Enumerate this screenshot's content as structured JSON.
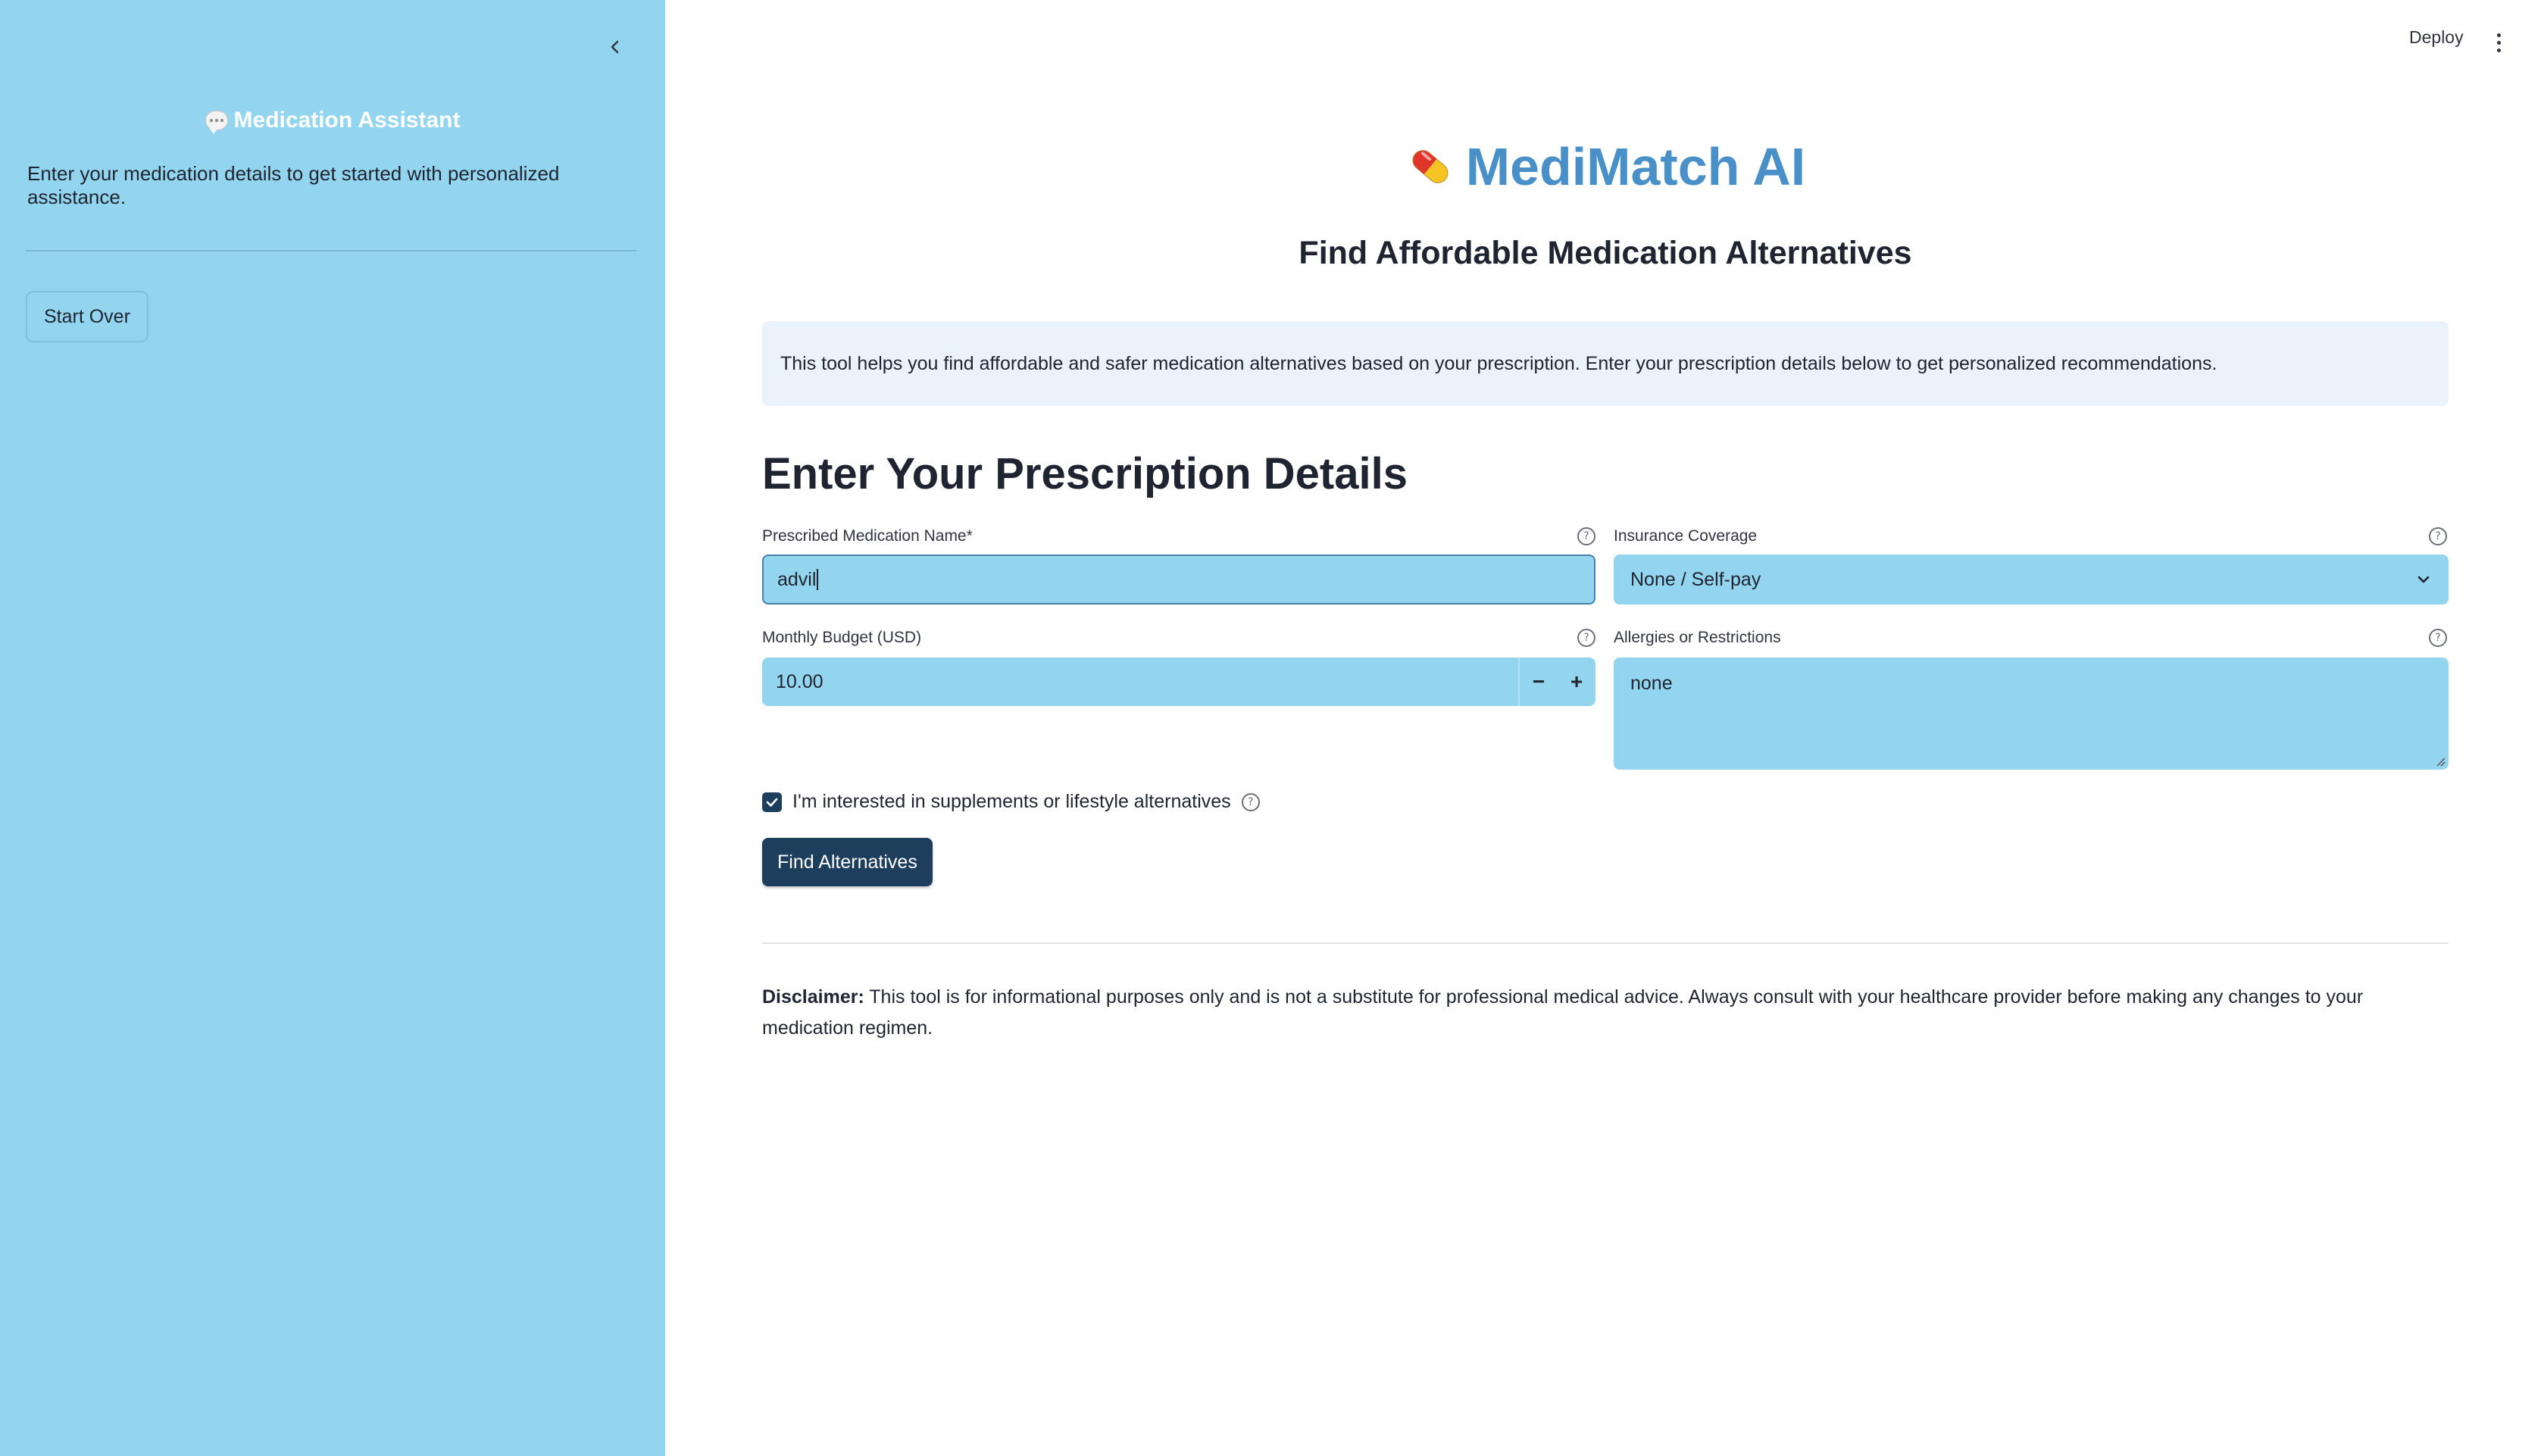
{
  "sidebar": {
    "collapse_icon": "chevron-left-icon",
    "title_icon": "speech-bubble-icon",
    "title": "Medication Assistant",
    "description": "Enter your medication details to get started with personalized assistance.",
    "start_over_label": "Start Over"
  },
  "topbar": {
    "deploy_label": "Deploy",
    "menu_icon": "kebab-menu-icon"
  },
  "header": {
    "app_icon": "pill-icon",
    "app_title": "MediMatch AI",
    "subtitle": "Find Affordable Medication Alternatives"
  },
  "info": {
    "text": "This tool helps you find affordable and safer medication alternatives based on your prescription. Enter your prescription details below to get personalized recommendations."
  },
  "form": {
    "heading": "Enter Your Prescription Details",
    "medication": {
      "label": "Prescribed Medication Name*",
      "value": "advil"
    },
    "insurance": {
      "label": "Insurance Coverage",
      "selected": "None / Self-pay"
    },
    "budget": {
      "label": "Monthly Budget (USD)",
      "value": "10.00",
      "minus": "−",
      "plus": "+"
    },
    "allergies": {
      "label": "Allergies or Restrictions",
      "value": "none"
    },
    "supplements": {
      "label": "I'm interested in supplements or lifestyle alternatives",
      "checked": true
    },
    "submit_label": "Find Alternatives"
  },
  "disclaimer": {
    "label": "Disclaimer:",
    "text": " This tool is for informational purposes only and is not a substitute for professional medical advice. Always consult with your healthcare provider before making any changes to your medication regimen."
  },
  "colors": {
    "sidebar_bg": "#93d4ef",
    "input_bg": "#93d4ef",
    "title_blue": "#4a90c8",
    "button_navy": "#1e3e5e",
    "info_bg": "#eaf2fb"
  }
}
